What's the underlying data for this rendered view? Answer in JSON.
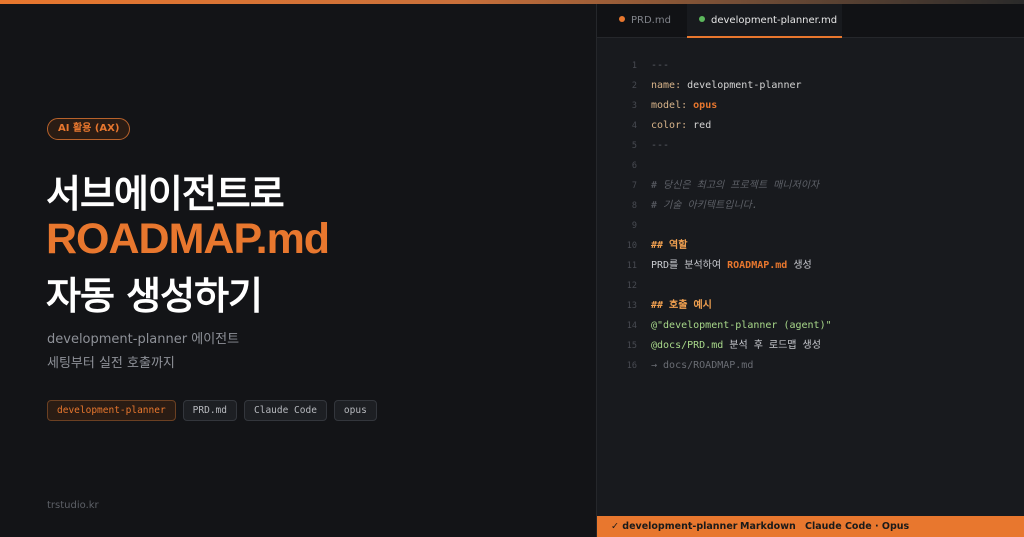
{
  "hero": {
    "badge": "AI 활용 (AX)",
    "title_line1": "서브에이전트로",
    "title_line2": "ROADMAP.md",
    "title_line3": "자동 생성하기",
    "subtitle_line1": "development-planner 에이전트",
    "subtitle_line2": "세팅부터 실전 호출까지",
    "tags": [
      "development-planner",
      "PRD.md",
      "Claude Code",
      "opus"
    ],
    "brand": "trstudio.kr"
  },
  "editor": {
    "tabs": [
      {
        "label": "PRD.md",
        "active": false
      },
      {
        "label": "development-planner.md",
        "active": true
      }
    ],
    "lines": [
      {
        "n": "1",
        "parts": [
          {
            "t": "---",
            "c": "c-dim"
          }
        ]
      },
      {
        "n": "2",
        "parts": [
          {
            "t": "name: ",
            "c": "c-key"
          },
          {
            "t": "development-planner",
            "c": "c-val"
          }
        ]
      },
      {
        "n": "3",
        "parts": [
          {
            "t": "model: ",
            "c": "c-key"
          },
          {
            "t": "opus",
            "c": "c-opus"
          }
        ]
      },
      {
        "n": "4",
        "parts": [
          {
            "t": "color: ",
            "c": "c-key"
          },
          {
            "t": "red",
            "c": "c-val"
          }
        ]
      },
      {
        "n": "5",
        "parts": [
          {
            "t": "---",
            "c": "c-dim"
          }
        ]
      },
      {
        "n": "6",
        "parts": []
      },
      {
        "n": "7",
        "parts": [
          {
            "t": "# 당신은 최고의 프로젝트 매니저이자",
            "c": "c-comment"
          }
        ]
      },
      {
        "n": "8",
        "parts": [
          {
            "t": "# 기술 아키텍트입니다.",
            "c": "c-comment"
          }
        ]
      },
      {
        "n": "9",
        "parts": []
      },
      {
        "n": "10",
        "parts": [
          {
            "t": "## 역할",
            "c": "c-heading"
          }
        ]
      },
      {
        "n": "11",
        "parts": [
          {
            "t": "PRD를 분석하여 ",
            "c": "c-text"
          },
          {
            "t": "ROADMAP.md",
            "c": "c-bold-orange"
          },
          {
            "t": " 생성",
            "c": "c-text"
          }
        ]
      },
      {
        "n": "12",
        "parts": []
      },
      {
        "n": "13",
        "parts": [
          {
            "t": "## 호출 예시",
            "c": "c-heading"
          }
        ]
      },
      {
        "n": "14",
        "parts": [
          {
            "t": "@\"development-planner (agent)\"",
            "c": "c-green"
          }
        ]
      },
      {
        "n": "15",
        "parts": [
          {
            "t": "@docs/PRD.md",
            "c": "c-green"
          },
          {
            "t": " 분석 후 로드맵 생성",
            "c": "c-text"
          }
        ]
      },
      {
        "n": "16",
        "parts": [
          {
            "t": "→ docs/ROADMAP.md",
            "c": "c-arrow"
          }
        ]
      }
    ],
    "status": {
      "item1": "✓ development-planner",
      "item2": "Markdown",
      "item3": "Claude Code · Opus"
    }
  },
  "colors": {
    "accent": "#e8772e",
    "background": "#131417",
    "editor_bg": "#181a1e"
  }
}
